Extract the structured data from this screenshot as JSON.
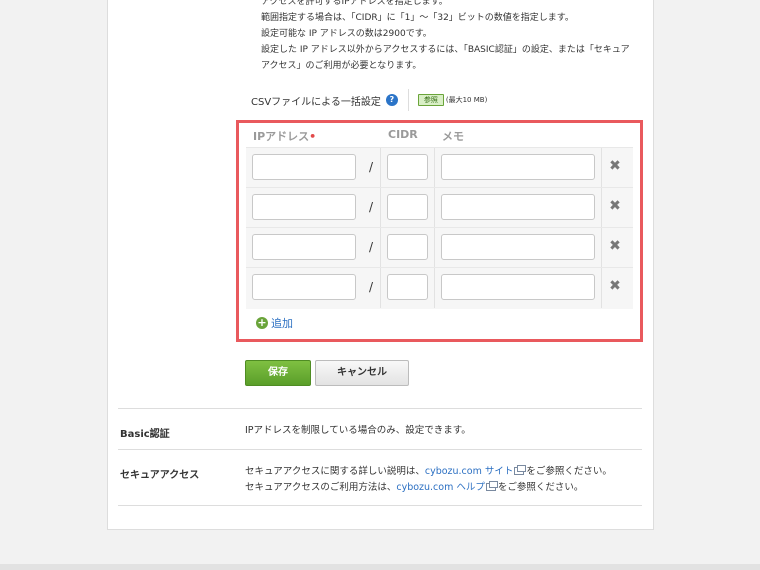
{
  "description": {
    "lines": [
      "アクセスを許可するIPアドレスを指定します。",
      "範囲指定する場合は、「CIDR」に「1」～「32」ビットの数値を指定します。",
      "設定可能な IP アドレスの数は2900です。",
      "設定した IP アドレス以外からアクセスするには、「BASIC認証」の設定、または「セキュア",
      "アクセス」のご利用が必要となります。"
    ]
  },
  "csv": {
    "label": "CSVファイルによる一括設定",
    "help_icon": "?",
    "browse_label": "参照",
    "max_size": "(最大10 MB)"
  },
  "ip_table": {
    "headers": {
      "ip": "IPアドレス",
      "required_mark": "•",
      "cidr": "CIDR",
      "memo": "メモ"
    },
    "separator": "/",
    "delete_icon": "✖",
    "rows": [
      {
        "ip": "",
        "cidr": "",
        "memo": ""
      },
      {
        "ip": "",
        "cidr": "",
        "memo": ""
      },
      {
        "ip": "",
        "cidr": "",
        "memo": ""
      },
      {
        "ip": "",
        "cidr": "",
        "memo": ""
      }
    ],
    "add_icon": "+",
    "add_label": "追加"
  },
  "buttons": {
    "save": "保存",
    "cancel": "キャンセル"
  },
  "basic_auth": {
    "label": "Basic認証",
    "text": "IPアドレスを制限している場合のみ、設定できます。"
  },
  "secure_access": {
    "label": "セキュアアクセス",
    "line1_pre": "セキュアアクセスに関する詳しい説明は、",
    "line1_link": "cybozu.com サイト",
    "line1_post": "をご参照ください。",
    "line2_pre": "セキュアアクセスのご利用方法は、",
    "line2_link": "cybozu.com ヘルプ",
    "line2_post": "をご参照ください。"
  },
  "colors": {
    "highlight_border": "#e9595d",
    "save_green": "#6aa43a",
    "link_blue": "#2b6fc2"
  }
}
